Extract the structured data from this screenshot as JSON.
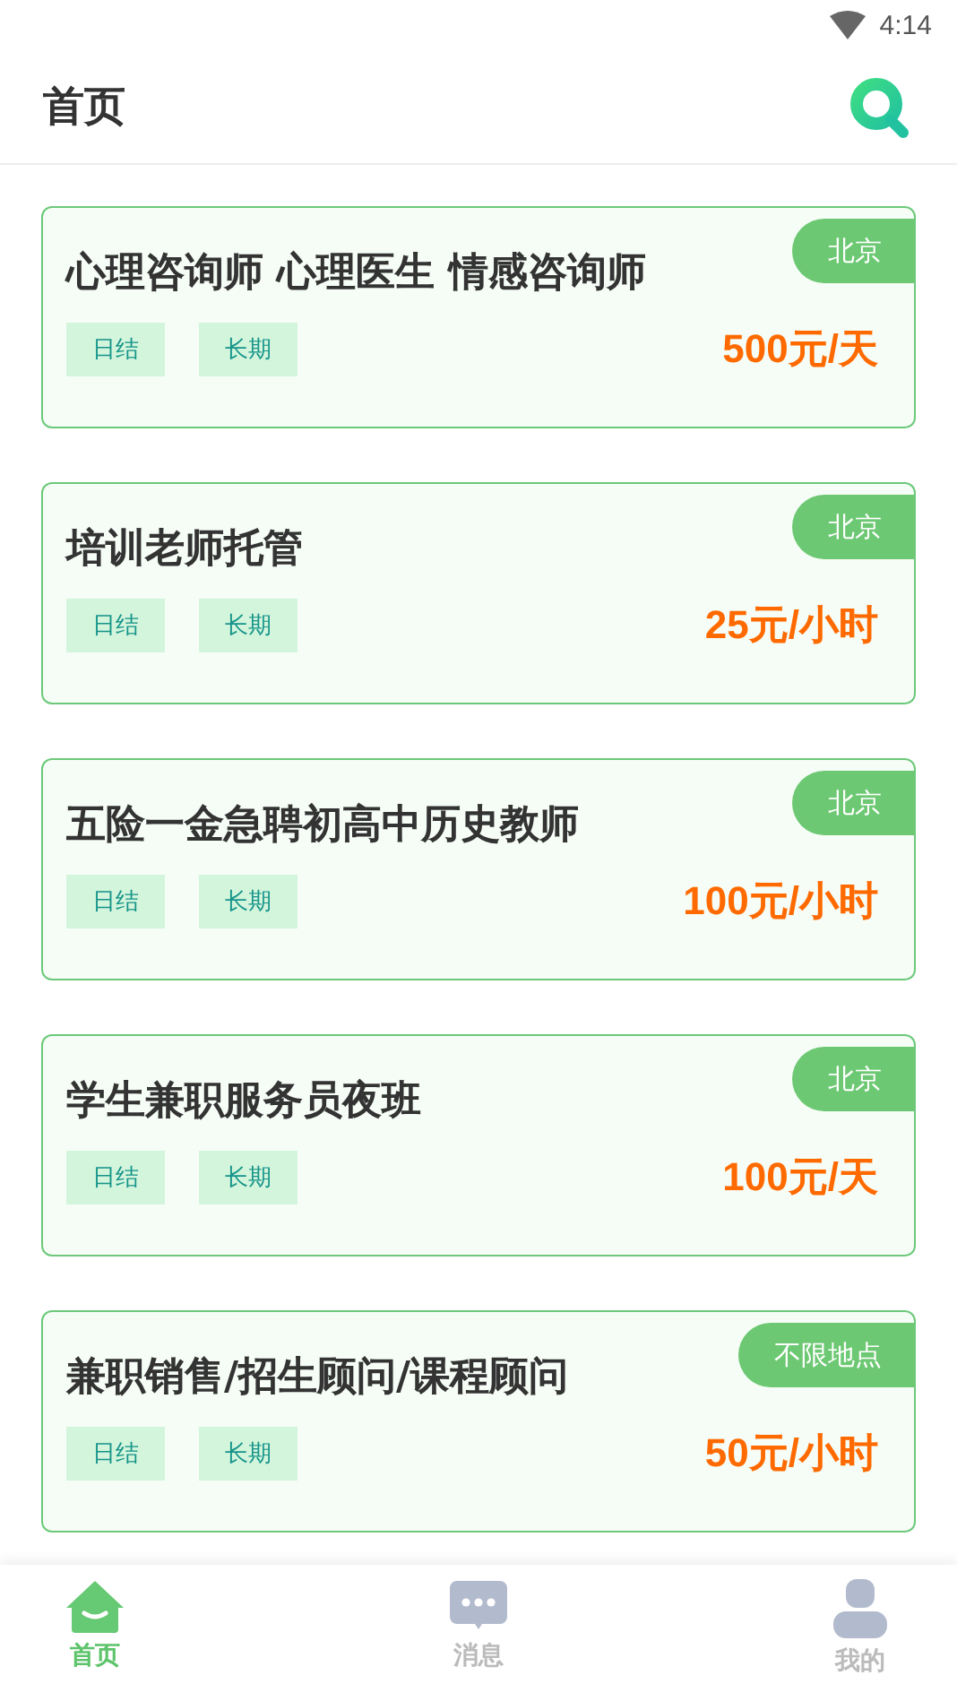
{
  "status_bar": {
    "time": "4:14"
  },
  "header": {
    "title": "首页"
  },
  "jobs": [
    {
      "title": "心理咨询师 心理医生 情感咨询师",
      "location": "北京",
      "tags": [
        "日结",
        "长期"
      ],
      "pay": "500元/天"
    },
    {
      "title": "培训老师托管",
      "location": "北京",
      "tags": [
        "日结",
        "长期"
      ],
      "pay": "25元/小时"
    },
    {
      "title": "五险一金急聘初高中历史教师",
      "location": "北京",
      "tags": [
        "日结",
        "长期"
      ],
      "pay": "100元/小时"
    },
    {
      "title": "学生兼职服务员夜班",
      "location": "北京",
      "tags": [
        "日结",
        "长期"
      ],
      "pay": "100元/天"
    },
    {
      "title": "兼职销售/招生顾问/课程顾问",
      "location": "不限地点",
      "tags": [
        "日结",
        "长期"
      ],
      "pay": "50元/小时"
    }
  ],
  "nav": [
    {
      "kind": "home",
      "label": "首页",
      "selected": true
    },
    {
      "kind": "message",
      "label": "消息",
      "selected": false
    },
    {
      "kind": "user",
      "label": "我的",
      "selected": false
    }
  ]
}
